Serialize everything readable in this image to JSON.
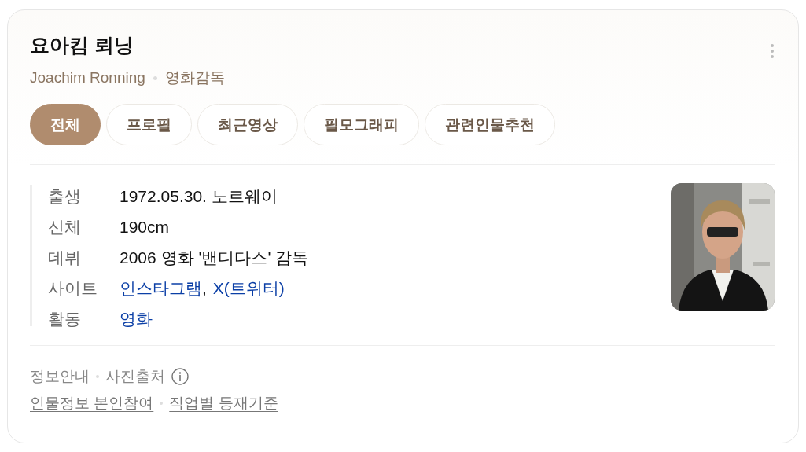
{
  "header": {
    "name": "요아킴 뢰닝",
    "english_name": "Joachim Ronning",
    "occupation": "영화감독"
  },
  "tabs": [
    {
      "label": "전체",
      "selected": true
    },
    {
      "label": "프로필",
      "selected": false
    },
    {
      "label": "최근영상",
      "selected": false
    },
    {
      "label": "필모그래피",
      "selected": false
    },
    {
      "label": "관련인물추천",
      "selected": false
    }
  ],
  "info": [
    {
      "label": "출생",
      "parts": [
        {
          "kind": "text",
          "text": "1972.05.30. 노르웨이"
        }
      ]
    },
    {
      "label": "신체",
      "parts": [
        {
          "kind": "text",
          "text": "190cm"
        }
      ]
    },
    {
      "label": "데뷔",
      "parts": [
        {
          "kind": "text",
          "text": "2006 영화 '밴디다스' 감독"
        }
      ]
    },
    {
      "label": "사이트",
      "parts": [
        {
          "kind": "link",
          "text": "인스타그램"
        },
        {
          "kind": "text",
          "text": ","
        },
        {
          "kind": "link",
          "text": "X(트위터)"
        }
      ]
    },
    {
      "label": "활동",
      "parts": [
        {
          "kind": "link",
          "text": "영화"
        }
      ]
    }
  ],
  "footer": {
    "notices": [
      "정보안내",
      "사진출처"
    ],
    "links": [
      "인물정보 본인참여",
      "직업별 등재기준"
    ]
  }
}
